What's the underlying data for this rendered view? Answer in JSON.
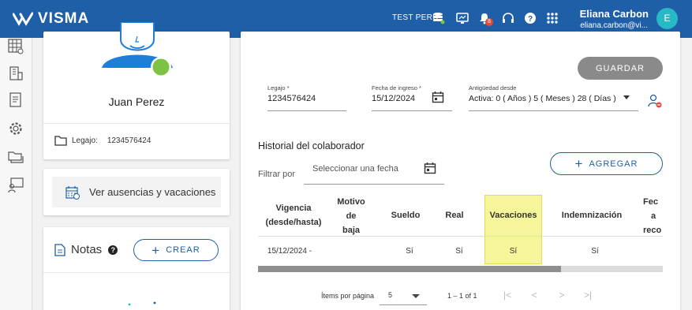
{
  "header": {
    "brand": "VISMA",
    "environment": "TEST PERÚ",
    "notifications_count": "8",
    "user_name": "Eliana Carbon",
    "user_email": "eliana.carbon@vi...",
    "avatar_initial": "E",
    "icons": [
      "database-icon",
      "monitor-icon",
      "bell-icon",
      "headset-icon",
      "help-icon",
      "apps-grid-icon"
    ]
  },
  "sidebar": {
    "icons": [
      "spreadsheet-icon",
      "building-icon",
      "document-icon",
      "settings-icon",
      "folders-icon",
      "teacher-icon"
    ]
  },
  "profile": {
    "name": "Juan Perez",
    "legajo_label": "Legajo:",
    "legajo_value": "1234576424",
    "status_color": "#7dc242"
  },
  "absences": {
    "label": "Ver ausencias y vacaciones"
  },
  "notes": {
    "title": "Notas",
    "help": "?",
    "create_label": "CREAR"
  },
  "form": {
    "save_label": "GUARDAR",
    "legajo_label": "Legajo *",
    "legajo_value": "1234576424",
    "ingreso_label": "Fecha de ingreso *",
    "ingreso_value": "15/12/2024",
    "antiguedad_label": "Antigüedad desde",
    "antiguedad_value": "Activa: 0 ( Años ) 5 ( Meses ) 28 ( Días )..."
  },
  "history": {
    "title": "Historial del colaborador",
    "filter_label": "Filtrar por",
    "filter_placeholder": "Seleccionar una fecha",
    "add_label": "AGREGAR",
    "columns": {
      "vigencia_1": "Vigencia",
      "vigencia_2": "(desde/hasta)",
      "motivo_1": "Motivo",
      "motivo_2": "de",
      "motivo_3": "baja",
      "sueldo": "Sueldo",
      "real": "Real",
      "vacaciones": "Vacaciones",
      "indemnizacion": "Indemnización",
      "fecha_1": "Fec",
      "fecha_2": "a",
      "fecha_3": "reco"
    },
    "rows": [
      {
        "vigencia": "15/12/2024 -",
        "sueldo": "Sí",
        "real": "Sí",
        "vacaciones": "Sí",
        "indemnizacion": "Sí"
      }
    ],
    "highlight_color": "#f6f59a"
  },
  "pagination": {
    "items_label": "Ítems por página",
    "per_page": "5",
    "range": "1 – 1 of 1",
    "first": "|<",
    "prev": "<",
    "next": ">",
    "last": ">|"
  }
}
